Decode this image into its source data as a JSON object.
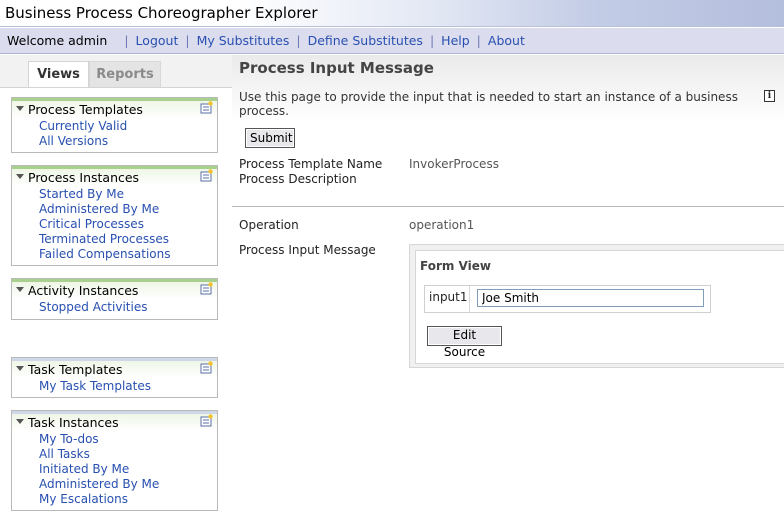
{
  "window": {
    "title": "Business Process Choreographer Explorer"
  },
  "nav": {
    "welcome": "Welcome admin",
    "links": [
      "Logout",
      "My Substitutes",
      "Define Substitutes",
      "Help",
      "About"
    ]
  },
  "sidebar": {
    "tabs": [
      "Views",
      "Reports"
    ],
    "active_tab": "Views",
    "panels": [
      {
        "title": "Process Templates",
        "items": [
          "Currently Valid",
          "All Versions"
        ]
      },
      {
        "title": "Process Instances",
        "items": [
          "Started By Me",
          "Administered By Me",
          "Critical Processes",
          "Terminated Processes",
          "Failed Compensations"
        ]
      },
      {
        "title": "Activity Instances",
        "items": [
          "Stopped Activities"
        ]
      },
      {
        "title": "Task Templates",
        "items": [
          "My Task Templates"
        ]
      },
      {
        "title": "Task Instances",
        "items": [
          "My To-dos",
          "All Tasks",
          "Initiated By Me",
          "Administered By Me",
          "My Escalations"
        ]
      }
    ]
  },
  "main": {
    "title": "Process Input Message",
    "description": "Use this page to provide the input that is needed to start an instance of a business process.",
    "info_icon_text": "i",
    "submit_label": "Submit",
    "fields": {
      "template_name_label": "Process Template Name",
      "template_name_value": "InvokerProcess",
      "description_label": "Process Description",
      "operation_label": "Operation",
      "operation_value": "operation1",
      "input_message_label": "Process Input Message"
    },
    "form": {
      "title": "Form View",
      "input_label": "input1",
      "input_value": "Joe Smith",
      "edit_source_label": "Edit Source"
    }
  },
  "colors": {
    "link": "#2850b0",
    "panel_accent": "#a9d18e",
    "nav_bg": "#dcdcef"
  }
}
